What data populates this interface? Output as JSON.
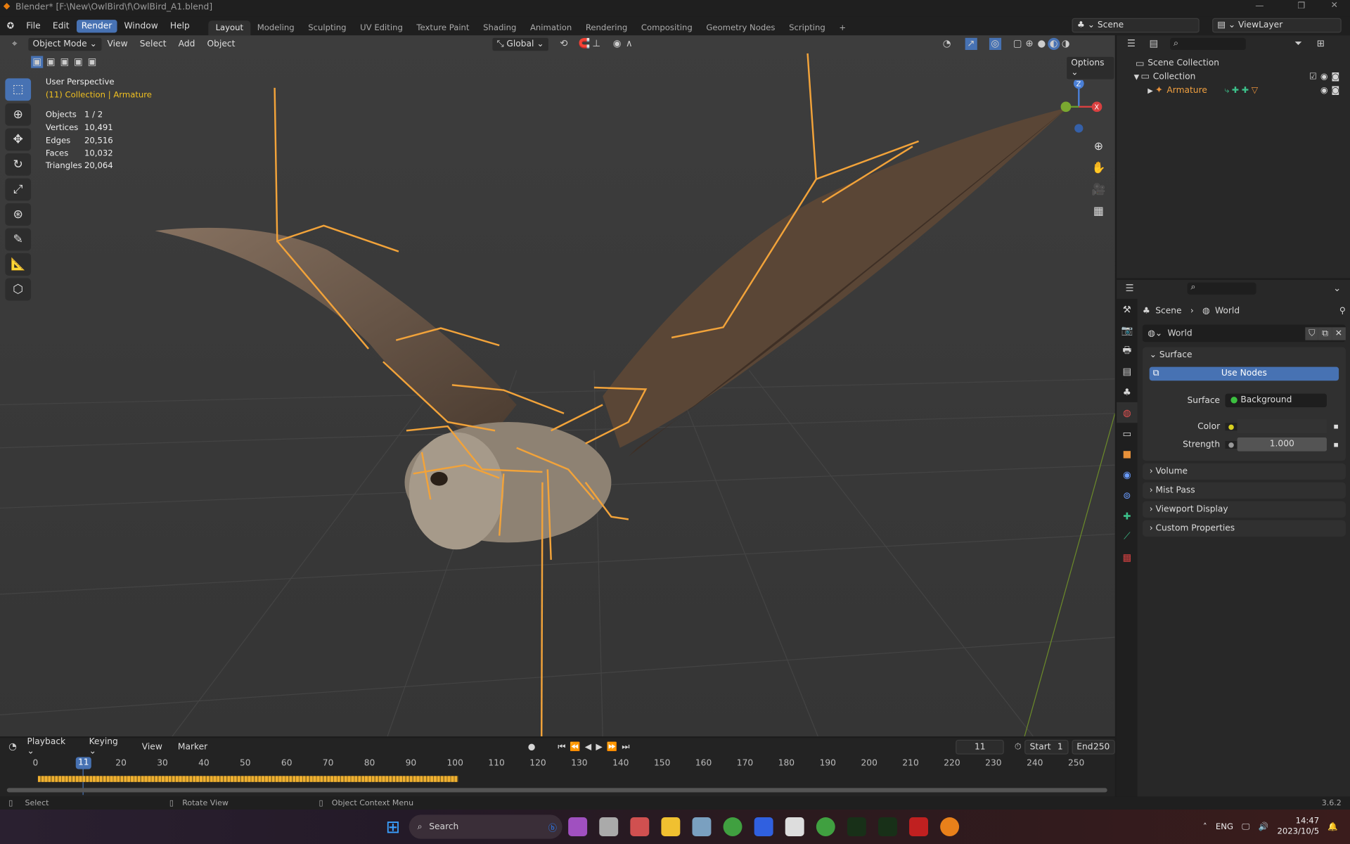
{
  "window": {
    "title": "Blender* [F:\\New\\OwlBird\\f\\OwlBird_A1.blend]"
  },
  "menu": [
    "File",
    "Edit",
    "Render",
    "Window",
    "Help"
  ],
  "workspaces": [
    "Layout",
    "Modeling",
    "Sculpting",
    "UV Editing",
    "Texture Paint",
    "Shading",
    "Animation",
    "Rendering",
    "Compositing",
    "Geometry Nodes",
    "Scripting",
    "+"
  ],
  "scene_field": "Scene",
  "viewlayer_field": "ViewLayer",
  "viewport": {
    "mode": "Object Mode",
    "menus": [
      "View",
      "Select",
      "Add",
      "Object"
    ],
    "transform": "Global",
    "options": "Options",
    "overlay_title": "User Perspective",
    "overlay_sub": "(11) Collection | Armature",
    "stats": [
      {
        "k": "Objects",
        "v": "1 / 2"
      },
      {
        "k": "Vertices",
        "v": "10,491"
      },
      {
        "k": "Edges",
        "v": "20,516"
      },
      {
        "k": "Faces",
        "v": "10,032"
      },
      {
        "k": "Triangles",
        "v": "20,064"
      }
    ],
    "gizmo": {
      "z": "Z",
      "x": "X"
    },
    "colors": {
      "bone": "#f2a33a",
      "bg": "#3b3b3b"
    }
  },
  "outliner": {
    "root": "Scene Collection",
    "collection": "Collection",
    "object": "Armature"
  },
  "properties": {
    "breadcrumb": [
      "Scene",
      "World"
    ],
    "world_name": "World",
    "surface_panel": "Surface",
    "use_nodes": "Use Nodes",
    "surface_label": "Surface",
    "surface_value": "Background",
    "color_label": "Color",
    "strength_label": "Strength",
    "strength_value": "1.000",
    "panels": [
      "Volume",
      "Mist Pass",
      "Viewport Display",
      "Custom Properties"
    ]
  },
  "timeline": {
    "menus": [
      "Playback",
      "Keying",
      "View",
      "Marker"
    ],
    "current_frame": "11",
    "start_label": "Start",
    "start": "1",
    "end_label": "End",
    "end": "250",
    "ticks": [
      "0",
      "20",
      "30",
      "40",
      "50",
      "60",
      "70",
      "80",
      "90",
      "100",
      "110",
      "120",
      "130",
      "140",
      "150",
      "160",
      "170",
      "180",
      "190",
      "200",
      "210",
      "220",
      "230",
      "240",
      "250"
    ]
  },
  "statusbar": {
    "select": "Select",
    "rotate": "Rotate View",
    "context": "Object Context Menu",
    "version": "3.6.2"
  },
  "taskbar": {
    "search": "Search",
    "lang": "ENG",
    "time": "14:47",
    "date": "2023/10/5"
  }
}
